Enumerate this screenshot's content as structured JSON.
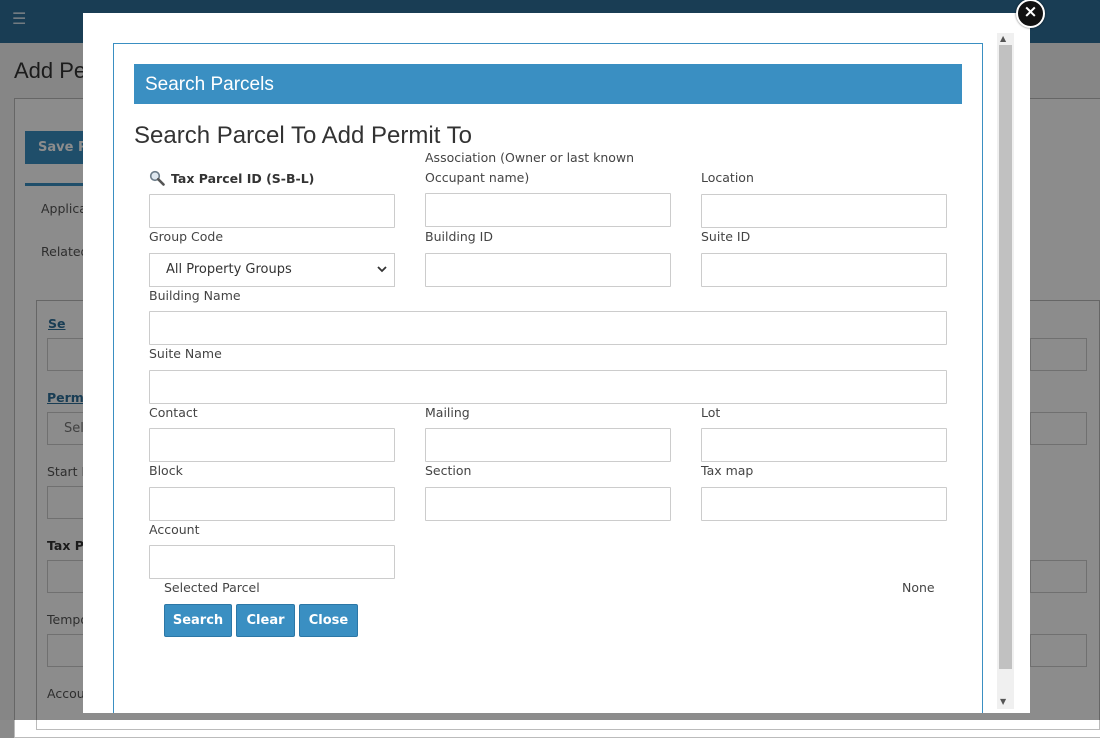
{
  "background": {
    "title": "Add Pe",
    "save_label": "Save Pe",
    "tab_label": "Applica",
    "related_label": "Related",
    "search_link": "Se",
    "permit_link": "Permi",
    "select_text": "Sel",
    "start_label": "Start D",
    "tax_label": "Tax Pa",
    "temp_label": "Tempo",
    "account_label": "Accou"
  },
  "modal": {
    "close_symbol": "×",
    "header": "Search Parcels",
    "title": "Search Parcel To Add Permit To",
    "fields": {
      "tax_parcel": {
        "label": "Tax Parcel ID (S-B-L)",
        "value": ""
      },
      "association": {
        "label_line1": "Association (Owner or last known",
        "label_line2": "Occupant name)",
        "value": ""
      },
      "location": {
        "label": "Location",
        "value": ""
      },
      "group_code": {
        "label": "Group Code",
        "selected": "All Property Groups"
      },
      "building_id": {
        "label": "Building ID",
        "value": ""
      },
      "suite_id": {
        "label": "Suite ID",
        "value": ""
      },
      "building_name": {
        "label": "Building Name",
        "value": ""
      },
      "suite_name": {
        "label": "Suite Name",
        "value": ""
      },
      "contact": {
        "label": "Contact",
        "value": ""
      },
      "mailing": {
        "label": "Mailing",
        "value": ""
      },
      "lot": {
        "label": "Lot",
        "value": ""
      },
      "block": {
        "label": "Block",
        "value": ""
      },
      "section": {
        "label": "Section",
        "value": ""
      },
      "tax_map": {
        "label": "Tax map",
        "value": ""
      },
      "account": {
        "label": "Account",
        "value": ""
      }
    },
    "selected_parcel_label": "Selected Parcel",
    "selected_parcel_value": "None",
    "buttons": {
      "search": "Search",
      "clear": "Clear",
      "close": "Close"
    }
  }
}
